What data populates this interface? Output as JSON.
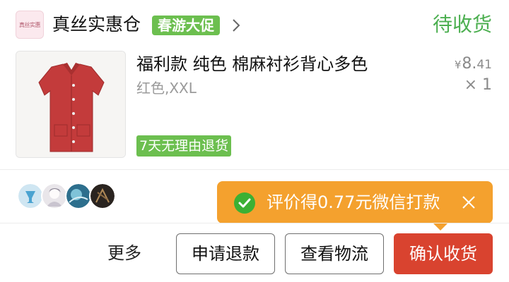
{
  "shop": {
    "logo_text": "真丝实惠",
    "name": "真丝实惠仓",
    "promo_badge": "春游大促",
    "order_status": "待收货"
  },
  "product": {
    "title": "福利款 纯色 棉麻衬衫背心多色",
    "variant": "红色,XXL",
    "return_policy": "7天无理由退货",
    "price_currency": "¥",
    "price_integer": "8.",
    "price_cents": "41",
    "quantity": "× 1",
    "image_icon": "red-sleeveless-shirt"
  },
  "reviewers": {
    "avatars": [
      "cup-avatar",
      "anime-avatar",
      "planet-avatar",
      "dark-avatar"
    ]
  },
  "tooltip": {
    "text": "评价得0.77元微信打款",
    "icon": "wechat-icon",
    "color": "#f4a12e"
  },
  "actions": {
    "more": "更多",
    "refund": "申请退款",
    "logistics": "查看物流",
    "confirm": "确认收货"
  },
  "colors": {
    "accent_green": "#4caf50",
    "badge_green": "#6cbf4f",
    "confirm_red": "#d9432f"
  }
}
